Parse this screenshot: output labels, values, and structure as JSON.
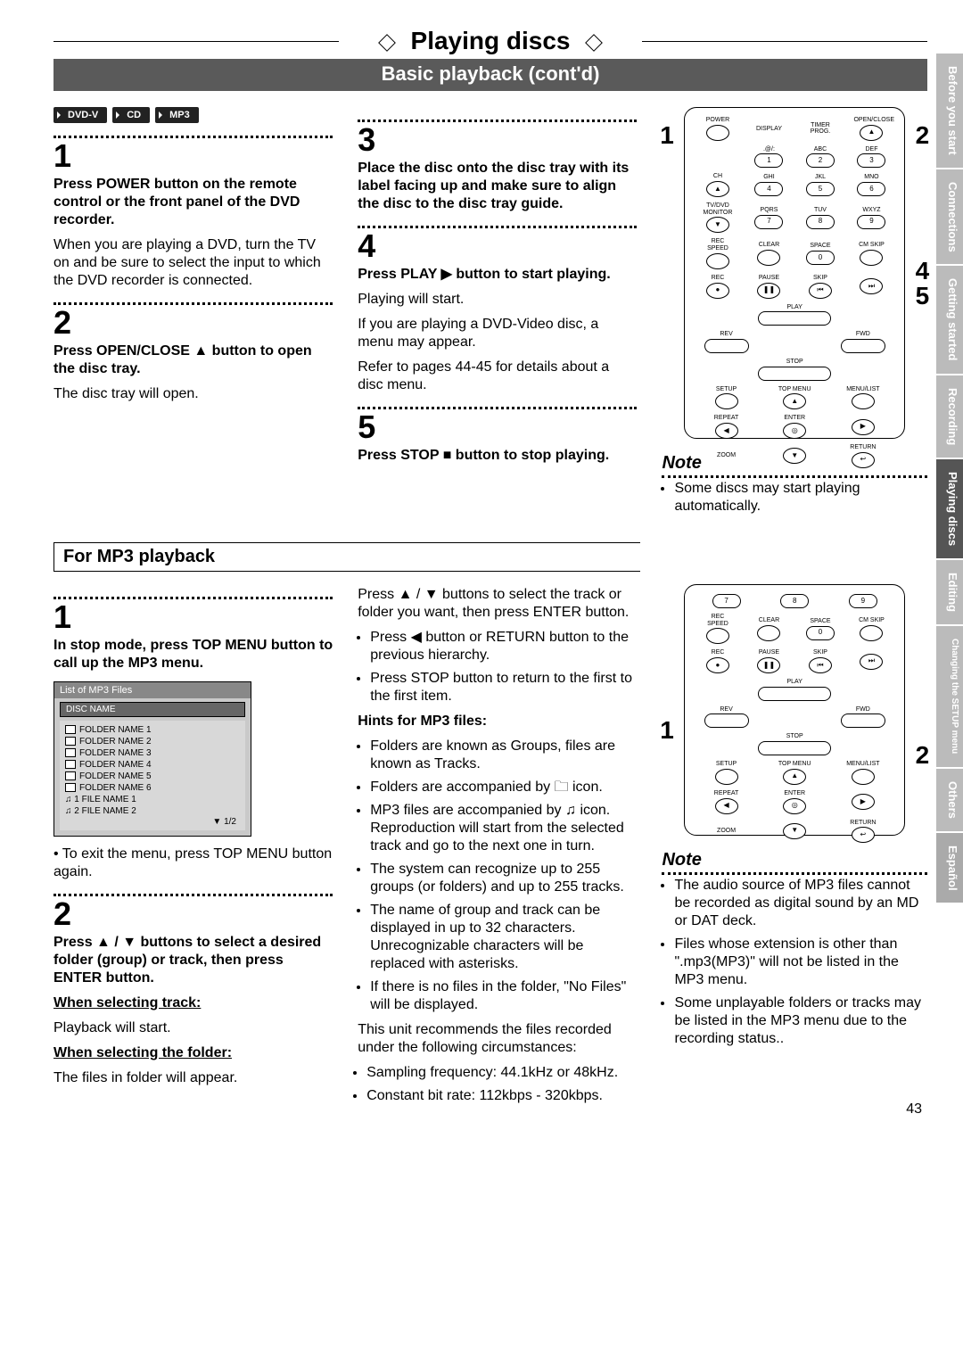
{
  "chapter_title": "Playing discs",
  "section_title": "Basic playback (cont'd)",
  "badges": [
    "DVD-V",
    "CD",
    "MP3"
  ],
  "basic": {
    "s1": {
      "bold": "Press POWER button on the remote control or the front panel of the DVD recorder.",
      "body": "When you are playing a DVD, turn the TV on and be sure to select the input to which the DVD recorder is connected."
    },
    "s2": {
      "bold": "Press OPEN/CLOSE ▲ button to open the disc tray.",
      "body": "The disc tray will open."
    },
    "s3": {
      "bold": "Place the disc onto the disc tray with its label facing up and make sure to align the disc to the disc tray guide."
    },
    "s4": {
      "bold": "Press PLAY ▶ button to start playing.",
      "body1": "Playing will start.",
      "body2": "If you are playing a DVD-Video disc, a menu may appear.",
      "body3": "Refer to pages 44-45 for details about a disc menu."
    },
    "s5": {
      "bold": "Press STOP ■ button to stop playing."
    }
  },
  "note1_title": "Note",
  "note1_item": "Some discs may start playing automatically.",
  "mp3_title": "For MP3 playback",
  "mp3": {
    "s1": {
      "bold": "In stop mode, press TOP MENU button to call up the MP3 menu.",
      "exit": "To exit the menu, press TOP MENU button again."
    },
    "s2": {
      "bold": "Press ▲ / ▼ buttons to select a desired folder (group) or track, then press ENTER button.",
      "wst_h": "When selecting track:",
      "wst_b": "Playback will start.",
      "wsf_h": "When selecting the folder:",
      "wsf_b": "The files in folder will appear."
    },
    "col2": {
      "lead": "Press ▲ / ▼ buttons to select the track or folder you want, then press ENTER button.",
      "b1": "Press ◀ button or RETURN button to the previous hierarchy.",
      "b2": "Press STOP button to return to the first to the first item.",
      "hints_h": "Hints for MP3 files:",
      "h1": "Folders are known as Groups, files are known as Tracks.",
      "h2": "Folders are accompanied by 🗀 icon.",
      "h3": "MP3 files are accompanied by ♫ icon. Reproduction will start from the selected track and go to the next one in turn.",
      "h4": "The system can recognize up to 255 groups (or folders) and up to 255 tracks.",
      "h5": "The name of group and track can be displayed in up to 32 characters. Unrecognizable characters will be replaced with asterisks.",
      "h6": "If there is no files in the folder, \"No Files\" will be displayed.",
      "rec": "This unit recommends the files recorded under the following circumstances:",
      "rec1": "Sampling frequency: 44.1kHz or 48kHz.",
      "rec2": "Constant bit rate: 112kbps - 320kbps."
    }
  },
  "note2_title": "Note",
  "note2": {
    "n1": "The audio source of MP3 files cannot be recorded as digital sound by an MD or DAT deck.",
    "n2": "Files whose extension is other than \".mp3(MP3)\" will not be listed in the MP3 menu.",
    "n3": "Some unplayable folders or tracks may be listed in the MP3 menu due to the recording status.."
  },
  "mp3list": {
    "header": "List of MP3 Files",
    "discname": "DISC NAME",
    "rows": [
      "FOLDER NAME 1",
      "FOLDER NAME 2",
      "FOLDER NAME 3",
      "FOLDER NAME 4",
      "FOLDER NAME 5",
      "FOLDER NAME 6",
      "1   FILE NAME 1",
      "2   FILE NAME 2"
    ],
    "pager": "1/2"
  },
  "remote": {
    "power": "POWER",
    "openclose": "OPEN/CLOSE",
    "display": "DISPLAY",
    "timer": "TIMER PROG.",
    "at": ".@/:",
    "abc": "ABC",
    "def": "DEF",
    "ch": "CH",
    "ghi": "GHI",
    "jkl": "JKL",
    "mno": "MNO",
    "monitor": "TV/DVD MONITOR",
    "pqrs": "PQRS",
    "tuv": "TUV",
    "wxyz": "WXYZ",
    "recspeed": "REC SPEED",
    "clear": "CLEAR",
    "space": "SPACE",
    "cmskip": "CM SKIP",
    "rec": "REC",
    "pause": "PAUSE",
    "skip": "SKIP",
    "play": "PLAY",
    "rev": "REV",
    "fwd": "FWD",
    "stop": "STOP",
    "setup": "SETUP",
    "topmenu": "TOP MENU",
    "menulist": "MENU/LIST",
    "repeat": "REPEAT",
    "enter": "ENTER",
    "zoom": "ZOOM",
    "return": "RETURN"
  },
  "callouts_a": {
    "c1": "1",
    "c2": "2",
    "c4": "4",
    "c5": "5"
  },
  "callouts_b": {
    "c1": "1",
    "c2": "2"
  },
  "tabs": [
    "Before you start",
    "Connections",
    "Getting started",
    "Recording",
    "Playing discs",
    "Editing",
    "Changing the SETUP menu",
    "Others",
    "Español"
  ],
  "tabs_active_index": 4,
  "page_number": "43"
}
